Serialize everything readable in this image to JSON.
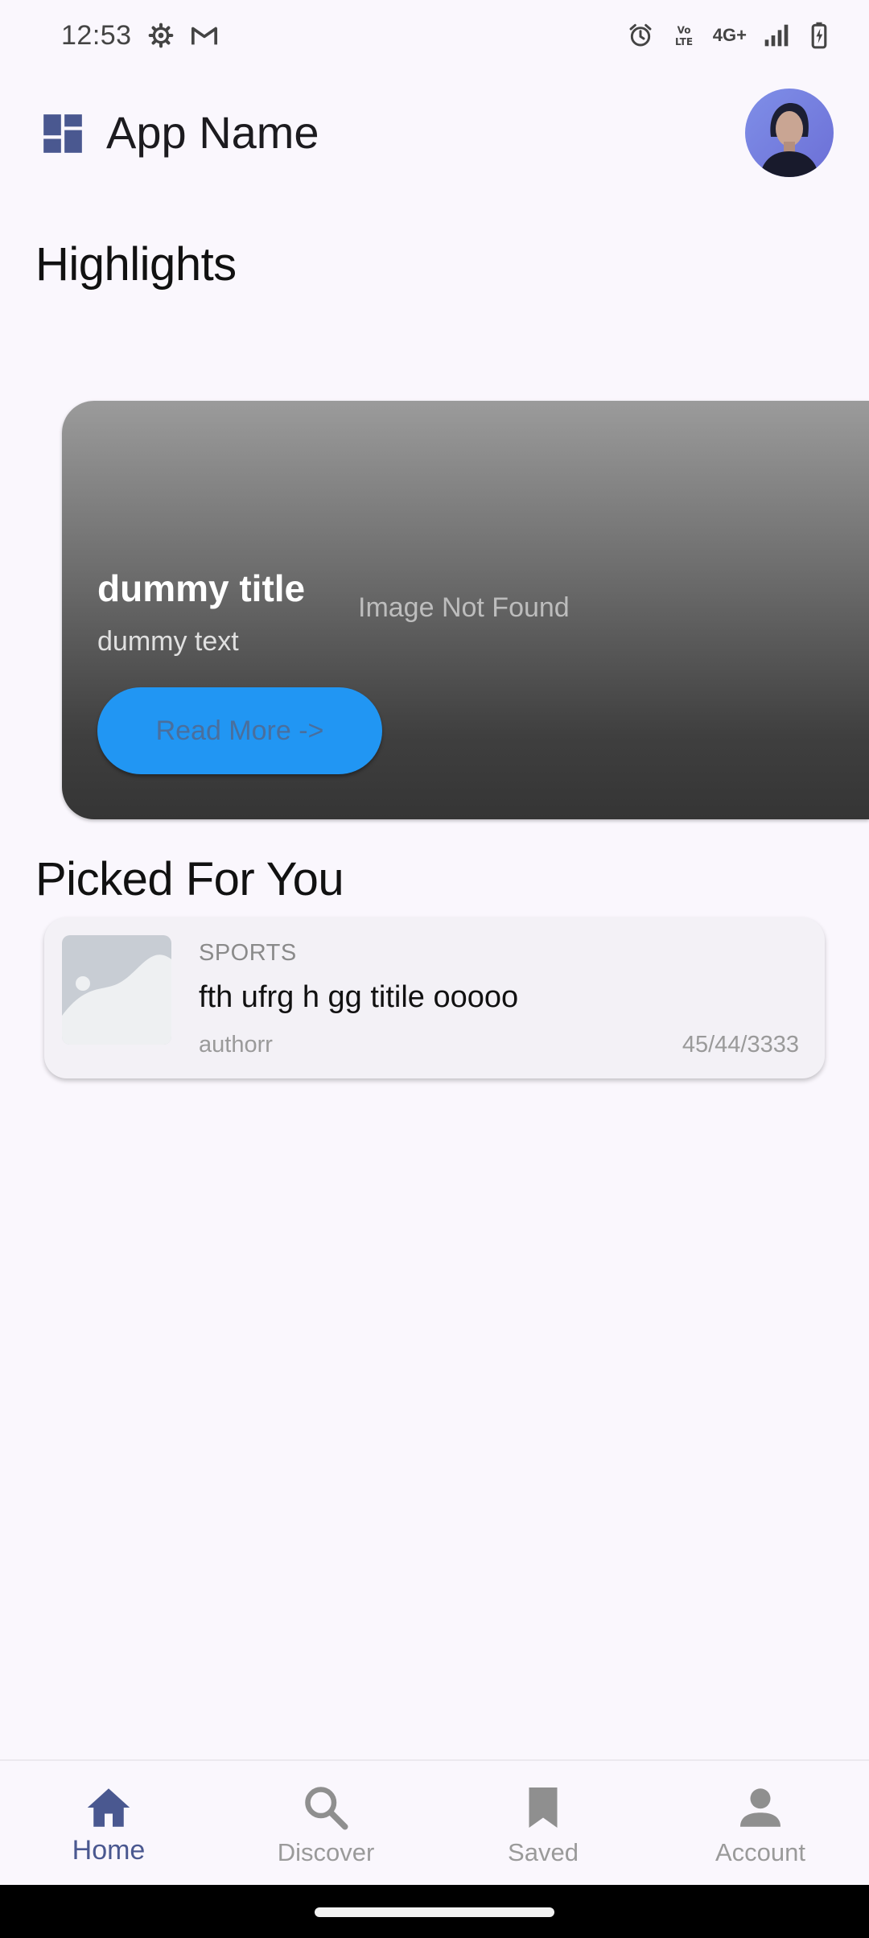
{
  "status_bar": {
    "time": "12:53",
    "left_icons": [
      "settings-gear-icon",
      "gmail-icon"
    ],
    "right_icons": [
      "alarm-icon",
      "volte-icon",
      "network-4g-icon",
      "signal-icon",
      "battery-charging-icon"
    ],
    "network_label": "4G+"
  },
  "app_bar": {
    "title": "App Name",
    "icon": "dashboard-icon",
    "avatar": "profile-avatar"
  },
  "highlights": {
    "heading": "Highlights",
    "card": {
      "title": "dummy title",
      "text": "dummy text",
      "image_placeholder": "Image Not Found",
      "button_label": "Read More ->"
    }
  },
  "picked": {
    "heading": "Picked For You",
    "items": [
      {
        "category": "SPORTS",
        "title": "fth ufrg h gg titile ooooo",
        "author": "authorr",
        "date": "45/44/3333",
        "thumbnail": "image-placeholder-icon"
      }
    ]
  },
  "bottom_nav": {
    "items": [
      {
        "label": "Home",
        "icon": "home-icon",
        "active": true
      },
      {
        "label": "Discover",
        "icon": "search-icon",
        "active": false
      },
      {
        "label": "Saved",
        "icon": "bookmark-icon",
        "active": false
      },
      {
        "label": "Account",
        "icon": "person-icon",
        "active": false
      }
    ]
  },
  "colors": {
    "background": "#faf7fd",
    "accent": "#4a5890",
    "button": "#2196f3"
  }
}
